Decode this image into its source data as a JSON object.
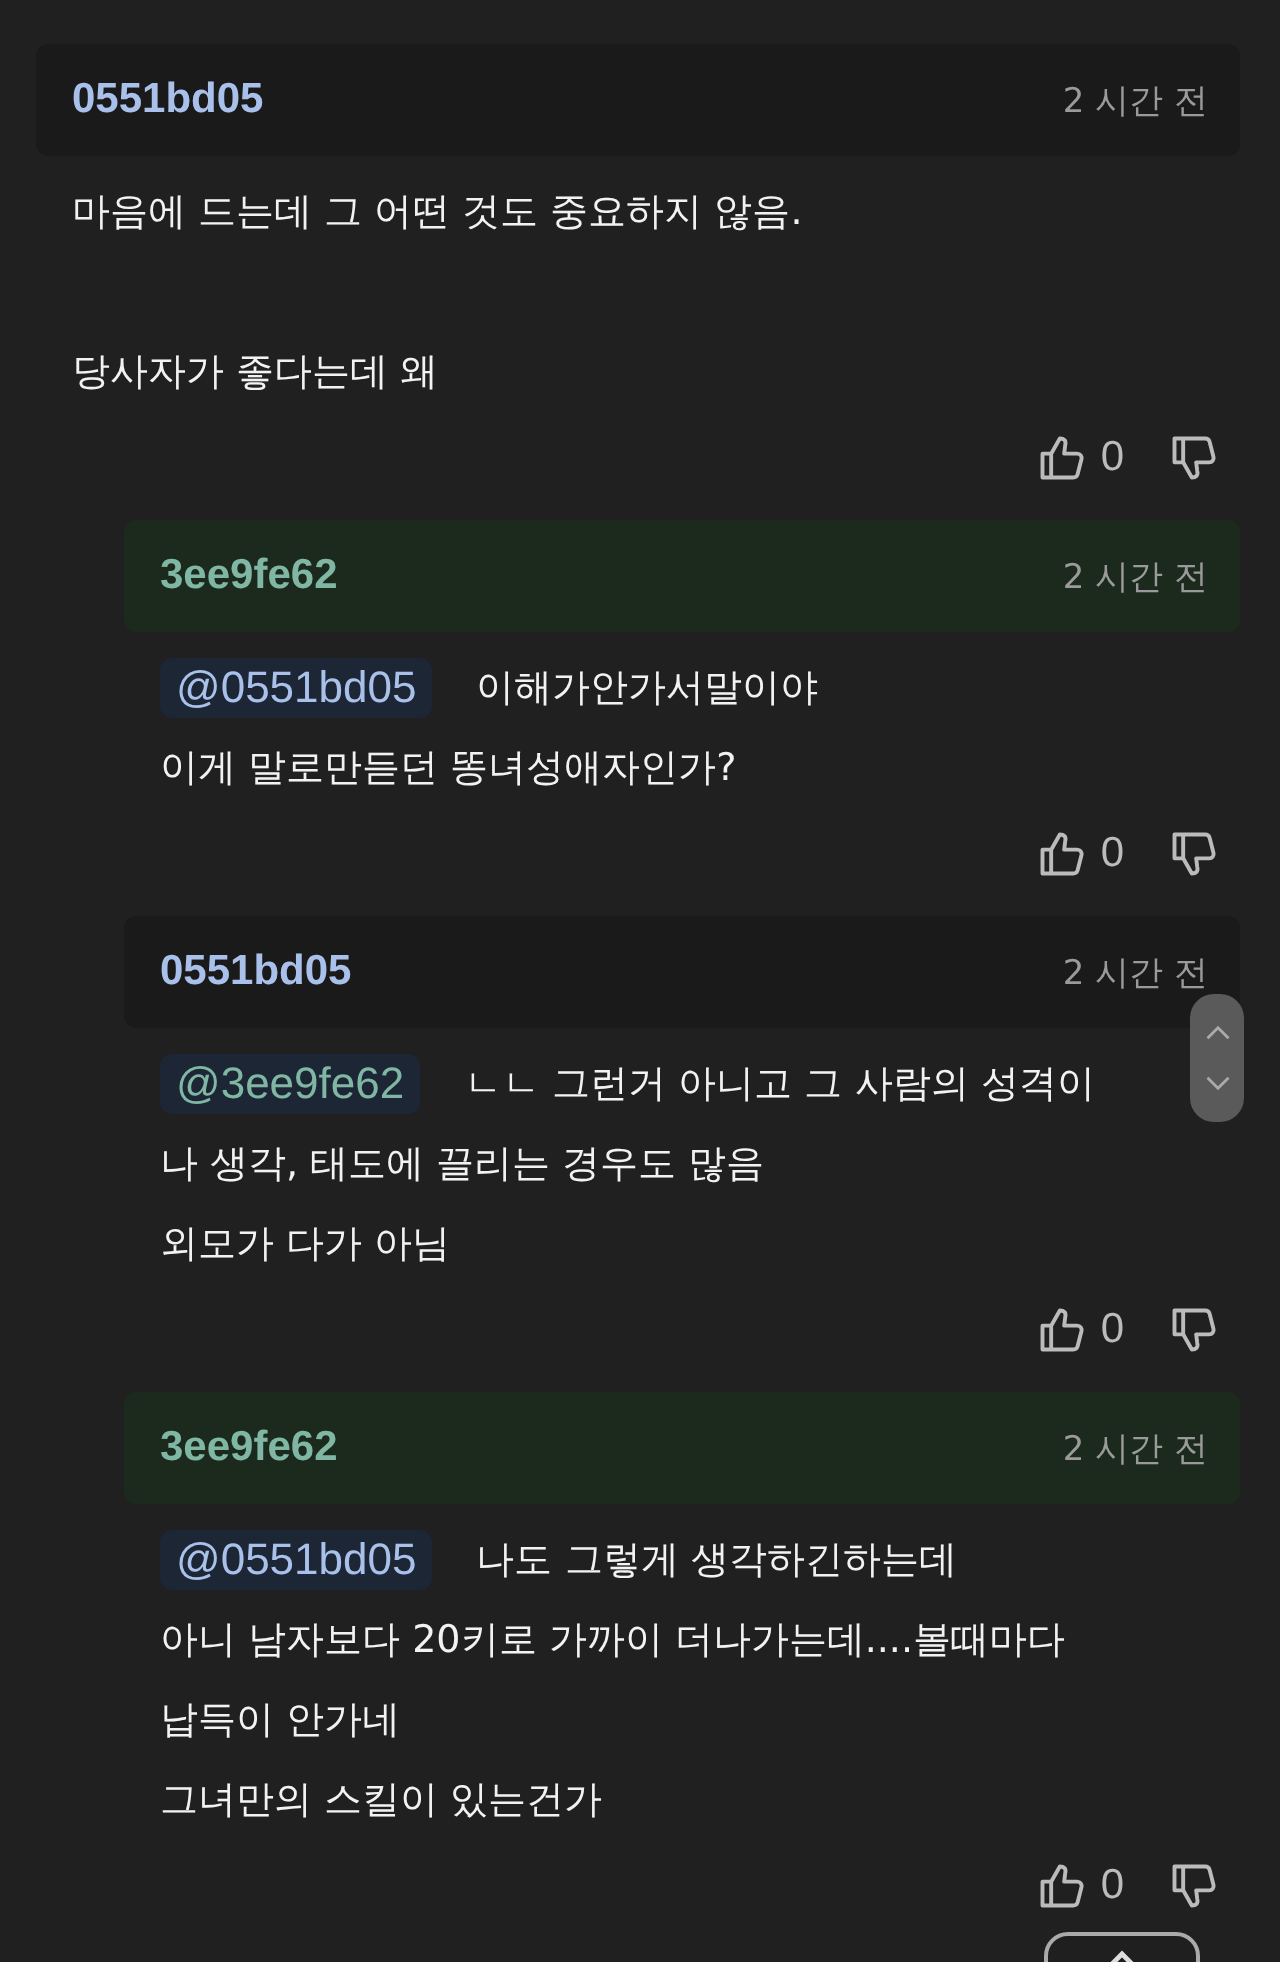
{
  "comments": [
    {
      "kind": "top",
      "author": "0551bd05",
      "color": "#a9c1ea",
      "highlighted": false,
      "time": "2 시간 전",
      "paragraphs": [
        [
          "마음에 드는데 그 어떤 것도 중요하지 않음."
        ],
        [
          "당사자가 좋다는데 왜"
        ]
      ],
      "likes": "0"
    },
    {
      "kind": "reply",
      "author": "3ee9fe62",
      "color": "#80b6a4",
      "highlighted": true,
      "time": "2 시간 전",
      "mention": {
        "text": "@0551bd05",
        "color": "#a9c1ea"
      },
      "paragraphs": [
        [
          "이해가안가서말이야",
          "이게 말로만듣던 똥녀성애자인가?"
        ]
      ],
      "likes": "0"
    },
    {
      "kind": "reply",
      "author": "0551bd05",
      "color": "#a9c1ea",
      "highlighted": false,
      "time": "2 시간 전",
      "mention": {
        "text": "@3ee9fe62",
        "color": "#80b6a4"
      },
      "paragraphs": [
        [
          "ㄴㄴ 그런거 아니고 그 사람의 성격이",
          "나 생각, 태도에 끌리는 경우도 많음",
          "외모가 다가 아님"
        ]
      ],
      "likes": "0"
    },
    {
      "kind": "reply",
      "author": "3ee9fe62",
      "color": "#80b6a4",
      "highlighted": true,
      "time": "2 시간 전",
      "mention": {
        "text": "@0551bd05",
        "color": "#a9c1ea"
      },
      "paragraphs": [
        [
          "나도 그렇게 생각하긴하는데",
          "아니 남자보다 20키로 가까이 더나가는데....볼때마다",
          "납득이 안가네",
          "그녀만의 스킬이 있는건가"
        ]
      ],
      "likes": "0"
    }
  ]
}
